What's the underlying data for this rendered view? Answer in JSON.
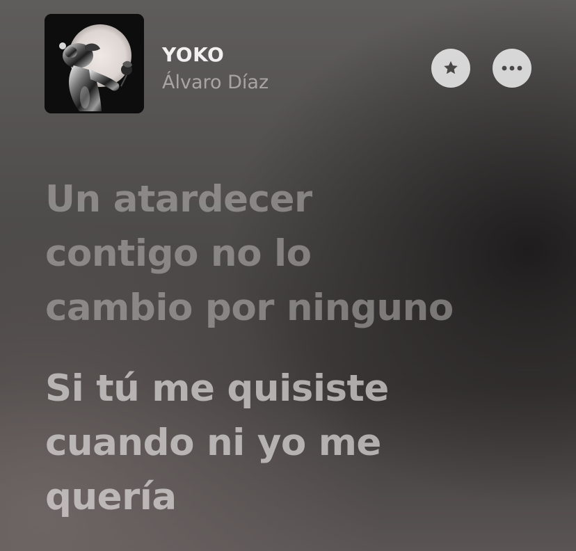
{
  "now_playing": {
    "title": "YOKO",
    "artist": "Álvaro Díaz",
    "artwork_icon": "album-artwork-chrome-figure",
    "favorite_icon": "star-icon",
    "more_icon": "ellipsis-icon"
  },
  "lyrics": {
    "stanzas": [
      {
        "lines": [
          "Un atardecer",
          "contigo no lo",
          "cambio por ninguno"
        ]
      },
      {
        "lines": [
          "Si tú me quisiste",
          "cuando ni yo me",
          "quería"
        ]
      }
    ]
  },
  "colors": {
    "button_bg": "#d8d6d6",
    "button_icon": "#4a4747",
    "title": "#f2f0f0"
  }
}
